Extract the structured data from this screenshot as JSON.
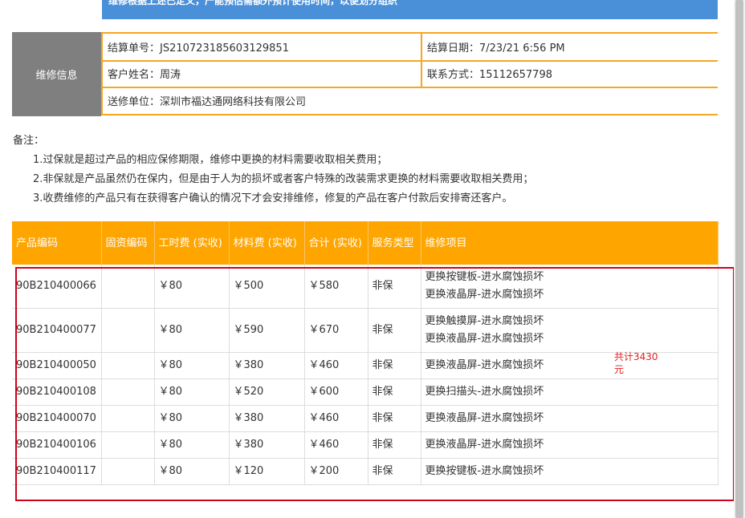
{
  "banner": {
    "text": "维修根据上述已定义，产能预估需额外预计使用时间，以便划分组织"
  },
  "repair_info": {
    "heading": "维修信息",
    "order_no": "结算单号：JS210723185603129851",
    "settle_date": "结算日期：7/23/21 6:56 PM",
    "customer_name": "客户姓名：周涛",
    "contact": "联系方式：15112657798",
    "sender": "送修单位：深圳市福达通网络科技有限公司"
  },
  "remarks": {
    "title": "备注：",
    "lines": [
      "1.过保就是超过产品的相应保修期限，维修中更换的材料需要收取相关费用；",
      "2.非保就是产品虽然仍在保内，但是由于人为的损坏或者客户特殊的改装需求更换的材料需要收取相关费用；",
      "3.收费维修的产品只有在获得客户确认的情况下才会安排维修，修复的产品在客户付款后安排寄还客户。"
    ]
  },
  "table": {
    "headers": [
      "产品编码",
      "固资编码",
      "工时费 (实收)",
      "材料费 (实收)",
      "合计 (实收)",
      "服务类型",
      "维修项目"
    ],
    "rows": [
      {
        "code": "90B210400066",
        "asset": "",
        "labor": "￥80",
        "material": "￥500",
        "total": "￥580",
        "service": "非保",
        "items": [
          "更换按键板-进水腐蚀损坏",
          "更换液晶屏-进水腐蚀损坏"
        ]
      },
      {
        "code": "90B210400077",
        "asset": "",
        "labor": "￥80",
        "material": "￥590",
        "total": "￥670",
        "service": "非保",
        "items": [
          "更换触摸屏-进水腐蚀损坏",
          "更换液晶屏-进水腐蚀损坏"
        ]
      },
      {
        "code": "90B210400050",
        "asset": "",
        "labor": "￥80",
        "material": "￥380",
        "total": "￥460",
        "service": "非保",
        "items": [
          "更换液晶屏-进水腐蚀损坏"
        ]
      },
      {
        "code": "90B210400108",
        "asset": "",
        "labor": "￥80",
        "material": "￥520",
        "total": "￥600",
        "service": "非保",
        "items": [
          "更换扫描头-进水腐蚀损坏"
        ]
      },
      {
        "code": "90B210400070",
        "asset": "",
        "labor": "￥80",
        "material": "￥380",
        "total": "￥460",
        "service": "非保",
        "items": [
          "更换液晶屏-进水腐蚀损坏"
        ]
      },
      {
        "code": "90B210400106",
        "asset": "",
        "labor": "￥80",
        "material": "￥380",
        "total": "￥460",
        "service": "非保",
        "items": [
          "更换液晶屏-进水腐蚀损坏"
        ]
      },
      {
        "code": "90B210400117",
        "asset": "",
        "labor": "￥80",
        "material": "￥120",
        "total": "￥200",
        "service": "非保",
        "items": [
          "更换按键板-进水腐蚀损坏"
        ]
      }
    ]
  },
  "annotation": {
    "sum_note": "共计3430元"
  },
  "colors": {
    "accent": "#ffa500",
    "banner": "#4a90d9",
    "head_gray": "#7f7f7f",
    "annotation_red": "#d0021b"
  }
}
